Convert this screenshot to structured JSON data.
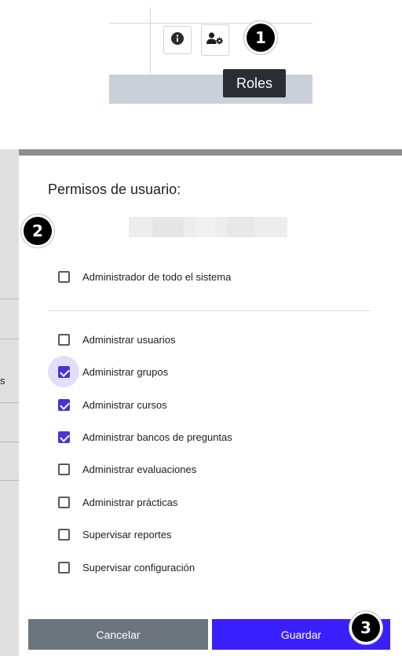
{
  "header": {
    "info_icon_name": "info-icon",
    "roles_icon_name": "user-gear-icon",
    "tooltip": "Roles"
  },
  "steps": {
    "one": "1",
    "two": "2",
    "three": "3"
  },
  "background": {
    "row_fragment": "s"
  },
  "dialog": {
    "title": "Permisos de usuario:",
    "global_permission": {
      "label": "Administrador de todo el sistema",
      "checked": false
    },
    "permissions": [
      {
        "label": "Administrar usuarios",
        "checked": false
      },
      {
        "label": "Administrar grupos",
        "checked": true,
        "focused": true
      },
      {
        "label": "Administrar cursos",
        "checked": true
      },
      {
        "label": "Administrar bancos de preguntas",
        "checked": true
      },
      {
        "label": "Administrar evaluaciones",
        "checked": false
      },
      {
        "label": "Administrar prácticas",
        "checked": false
      },
      {
        "label": "Supervisar reportes",
        "checked": false
      },
      {
        "label": "Supervisar configuración",
        "checked": false
      }
    ],
    "cancel_label": "Cancelar",
    "save_label": "Guardar"
  },
  "colors": {
    "accent": "#4b32d6",
    "save_button": "#3a20ff",
    "cancel_button": "#6c757d",
    "overlay": "#8e8e8e"
  }
}
